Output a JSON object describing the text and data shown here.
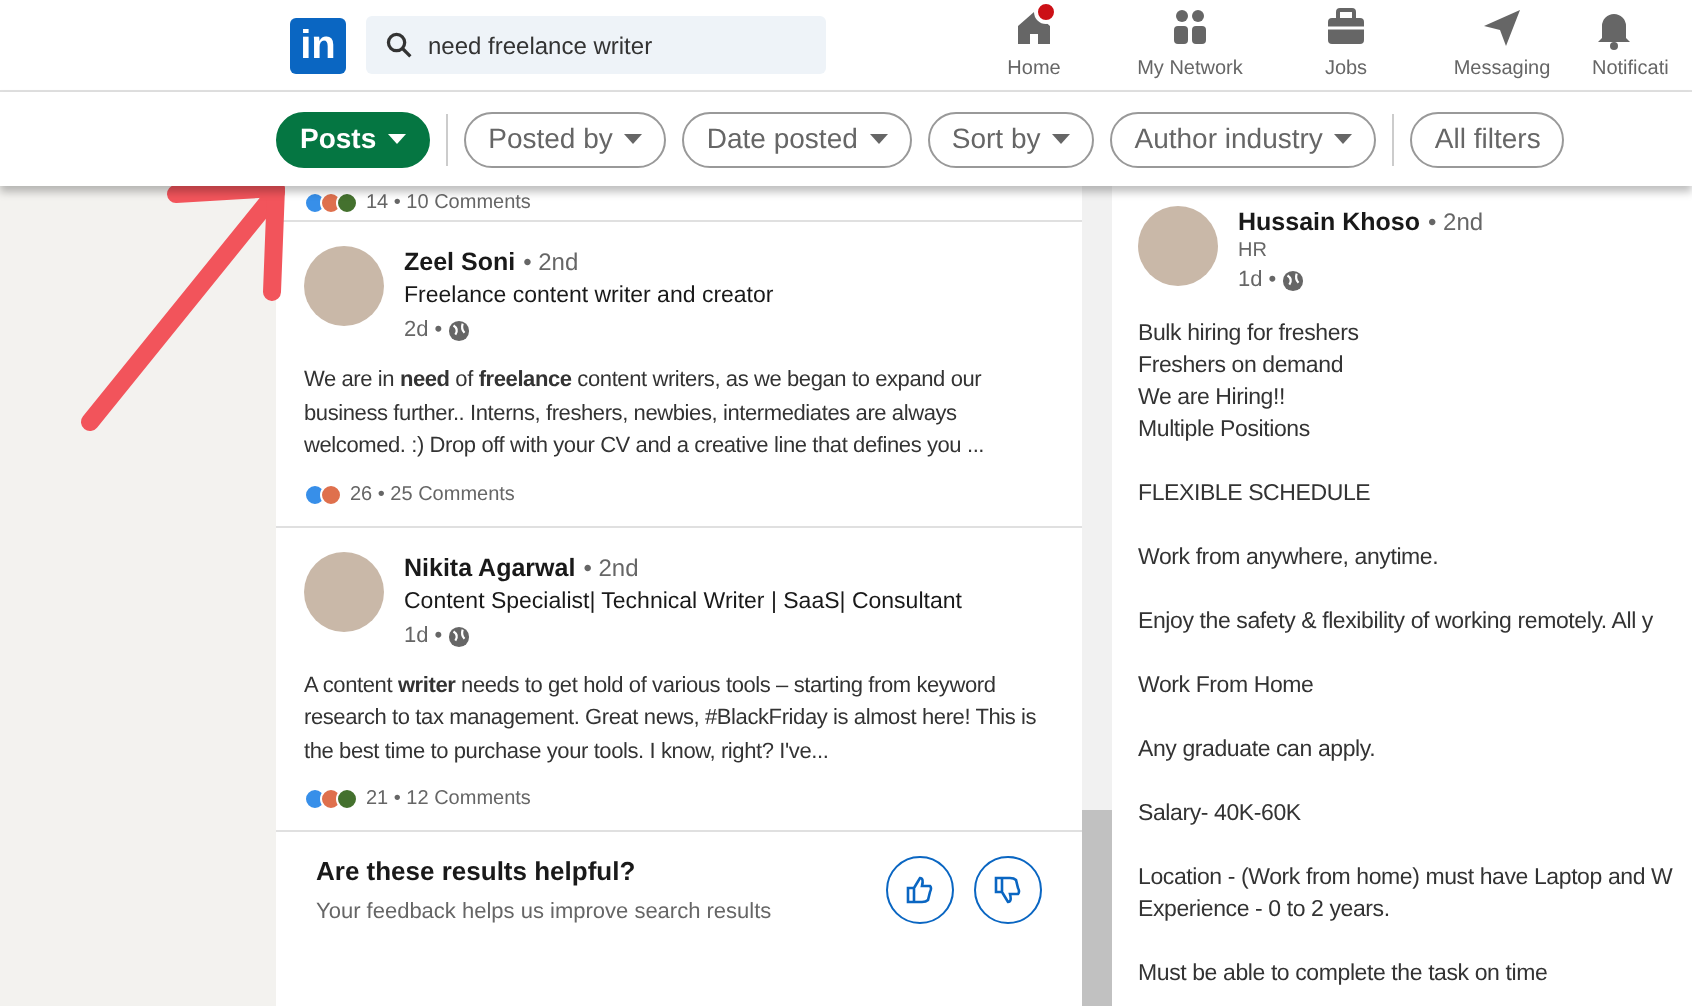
{
  "logo": {
    "text": "in"
  },
  "search": {
    "value": "need freelance writer"
  },
  "nav": [
    {
      "kind": "home",
      "label": "Home",
      "badge": true
    },
    {
      "kind": "network",
      "label": "My Network",
      "badge": false
    },
    {
      "kind": "jobs",
      "label": "Jobs",
      "badge": false
    },
    {
      "kind": "messaging",
      "label": "Messaging",
      "badge": false
    },
    {
      "kind": "bell",
      "label": "Notificati",
      "badge": false
    }
  ],
  "filters": [
    {
      "label": "Posts",
      "selected": true,
      "has_menu": true
    },
    {
      "label": "Posted by",
      "selected": false,
      "has_menu": true
    },
    {
      "label": "Date posted",
      "selected": false,
      "has_menu": true
    },
    {
      "label": "Sort by",
      "selected": false,
      "has_menu": true
    },
    {
      "label": "Author industry",
      "selected": false,
      "has_menu": true
    },
    {
      "label": "All filters",
      "selected": false,
      "has_menu": false
    }
  ],
  "previous_post": {
    "reactions": "14 • 10 Comments"
  },
  "posts": [
    {
      "name": "Zeel Soni",
      "degree": "• 2nd",
      "headline": "Freelance content writer and creator",
      "time": "2d •",
      "text": "We are in **need** of **freelance** content writers, as we began to expand our business further.. Interns, freshers, newbies, intermediates are always welcomed. :) Drop off with your CV and a creative line that defines you ...",
      "reactions": "26 • 25 Comments"
    },
    {
      "name": "Nikita Agarwal",
      "degree": "• 2nd",
      "headline": "Content Specialist| Technical Writer | SaaS| Consultant",
      "time": "1d •",
      "text": "A content **writer** needs to get hold of various tools – starting from keyword research to tax management. Great news, #BlackFriday is almost here! This is the best time to purchase your tools. I know, right? I've...",
      "reactions": "21 • 12 Comments"
    }
  ],
  "feedback": {
    "title": "Are these results helpful?",
    "subtitle": "Your feedback helps us improve search results"
  },
  "detail": {
    "name": "Hussain Khoso",
    "degree": "• 2nd",
    "headline": "HR",
    "time": "1d •",
    "paragraphs": [
      [
        "Bulk hiring for freshers",
        "Freshers on demand",
        "We are Hiring!!",
        "Multiple Positions"
      ],
      [
        "FLEXIBLE SCHEDULE"
      ],
      [
        "Work from anywhere, anytime."
      ],
      [
        "Enjoy the safety & flexibility of working remotely. All y"
      ],
      [
        "Work From Home"
      ],
      [
        "Any graduate can apply."
      ],
      [
        "Salary- 40K-60K"
      ],
      [
        "Location - (Work from home) must have Laptop and W",
        "Experience - 0 to 2 years."
      ],
      [
        "Must be able to complete the task on time"
      ]
    ]
  }
}
